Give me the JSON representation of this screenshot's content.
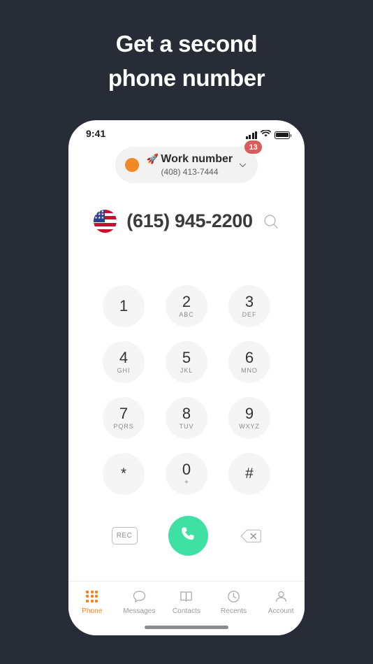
{
  "promo": {
    "headline_line1": "Get a second",
    "headline_line2": "phone number",
    "background_color": "#272c36",
    "text_color": "#ffffff"
  },
  "statusbar": {
    "time": "9:41",
    "signal_icon": "cellular-signal-icon",
    "wifi_icon": "wifi-icon",
    "battery_icon": "battery-full-icon"
  },
  "number_selector": {
    "dot_color": "#f28927",
    "emoji": "🚀",
    "title": "Work number",
    "subtitle": "(408) 413-7444",
    "chevron_icon": "chevron-down-icon",
    "badge_count": "13",
    "badge_color": "#d85c5c"
  },
  "dial_display": {
    "country_flag": "us-flag-icon",
    "number": "(615) 945-2200",
    "search_icon": "search-icon"
  },
  "keypad": {
    "keys": [
      {
        "digit": "1",
        "letters": ""
      },
      {
        "digit": "2",
        "letters": "ABC"
      },
      {
        "digit": "3",
        "letters": "DEF"
      },
      {
        "digit": "4",
        "letters": "GHI"
      },
      {
        "digit": "5",
        "letters": "JKL"
      },
      {
        "digit": "6",
        "letters": "MNO"
      },
      {
        "digit": "7",
        "letters": "PQRS"
      },
      {
        "digit": "8",
        "letters": "TUV"
      },
      {
        "digit": "9",
        "letters": "WXYZ"
      },
      {
        "digit": "*",
        "letters": ""
      },
      {
        "digit": "0",
        "letters": "+"
      },
      {
        "digit": "#",
        "letters": ""
      }
    ]
  },
  "actions": {
    "record_label": "REC",
    "call_icon": "phone-handset-icon",
    "call_button_color": "#3ee0a4",
    "delete_icon": "backspace-delete-icon"
  },
  "tabbar": {
    "active_color": "#f58220",
    "inactive_color": "#9a9a9a",
    "items": [
      {
        "label": "Phone",
        "icon": "dial-grid-icon"
      },
      {
        "label": "Messages",
        "icon": "chat-bubble-icon"
      },
      {
        "label": "Contacts",
        "icon": "open-book-icon"
      },
      {
        "label": "Recents",
        "icon": "clock-icon"
      },
      {
        "label": "Account",
        "icon": "person-icon"
      }
    ]
  }
}
